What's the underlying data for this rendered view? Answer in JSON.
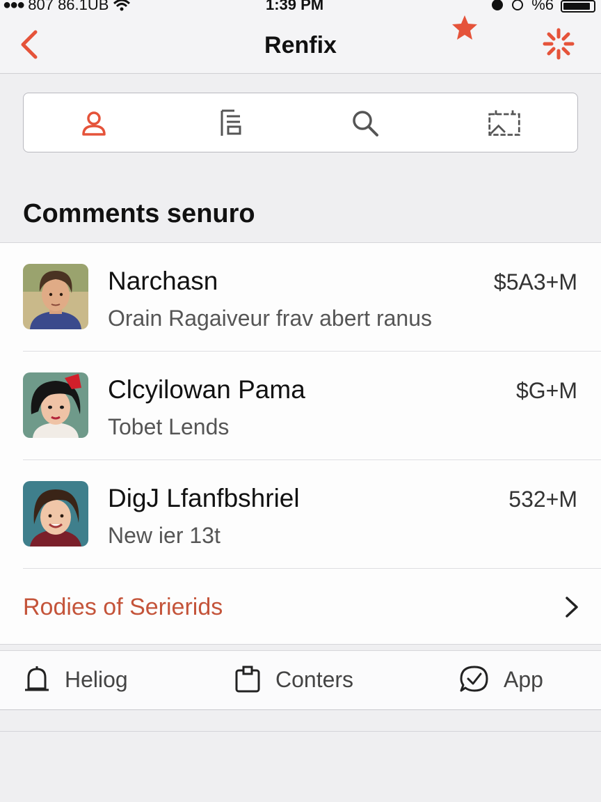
{
  "status": {
    "carrier": "807 86.1UB",
    "time": "1:39 PM",
    "right_text": "%6"
  },
  "nav": {
    "title": "Renfix"
  },
  "segments": [
    {
      "icon": "person-icon",
      "selected": true
    },
    {
      "icon": "list-icon",
      "selected": false
    },
    {
      "icon": "search-icon",
      "selected": false
    },
    {
      "icon": "screen-icon",
      "selected": false
    }
  ],
  "section": {
    "title": "Comments senuro"
  },
  "rows": [
    {
      "name": "Narchasn",
      "subtitle": "Orain Ragaiveur frav abert ranus",
      "amount": "$5A3+M"
    },
    {
      "name": "Clcyilowan Pama",
      "subtitle": "Tobet Lends",
      "amount": "$G+M"
    },
    {
      "name": "DigJ Lfanfbshriel",
      "subtitle": "New ier 13t",
      "amount": "532+M"
    }
  ],
  "link": {
    "label": "Rodies of Serierids"
  },
  "tabs": [
    {
      "label": "Heliog",
      "icon": "bell-icon"
    },
    {
      "label": "Conters",
      "icon": "clipboard-icon"
    },
    {
      "label": "App",
      "icon": "check-bubble-icon"
    }
  ],
  "colors": {
    "accent": "#e5533a",
    "link": "#c4543a"
  }
}
